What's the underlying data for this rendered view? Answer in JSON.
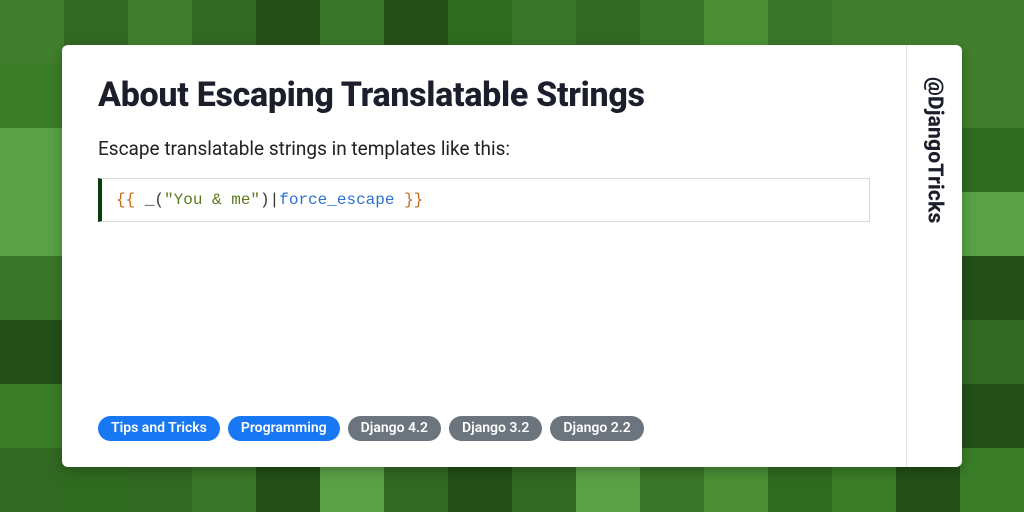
{
  "title": "About Escaping Translatable Strings",
  "lead": "Escape translatable strings in templates like this:",
  "code": {
    "open": "{{ ",
    "func": "_(",
    "str": "\"You & me\"",
    "func_close": ")",
    "pipe": "|",
    "filter": "force_escape",
    "close": " }}"
  },
  "tags": [
    {
      "label": "Tips and Tricks",
      "variant": "primary"
    },
    {
      "label": "Programming",
      "variant": "primary"
    },
    {
      "label": "Django 4.2",
      "variant": "muted"
    },
    {
      "label": "Django 3.2",
      "variant": "muted"
    },
    {
      "label": "Django 2.2",
      "variant": "muted"
    }
  ],
  "handle": "@DjangoTricks",
  "bg_palette": [
    "#2f6b1f",
    "#3a7d28",
    "#4a8f36",
    "#5aa146",
    "#244f18",
    "#3a7728",
    "#316923",
    "#407f2d"
  ]
}
